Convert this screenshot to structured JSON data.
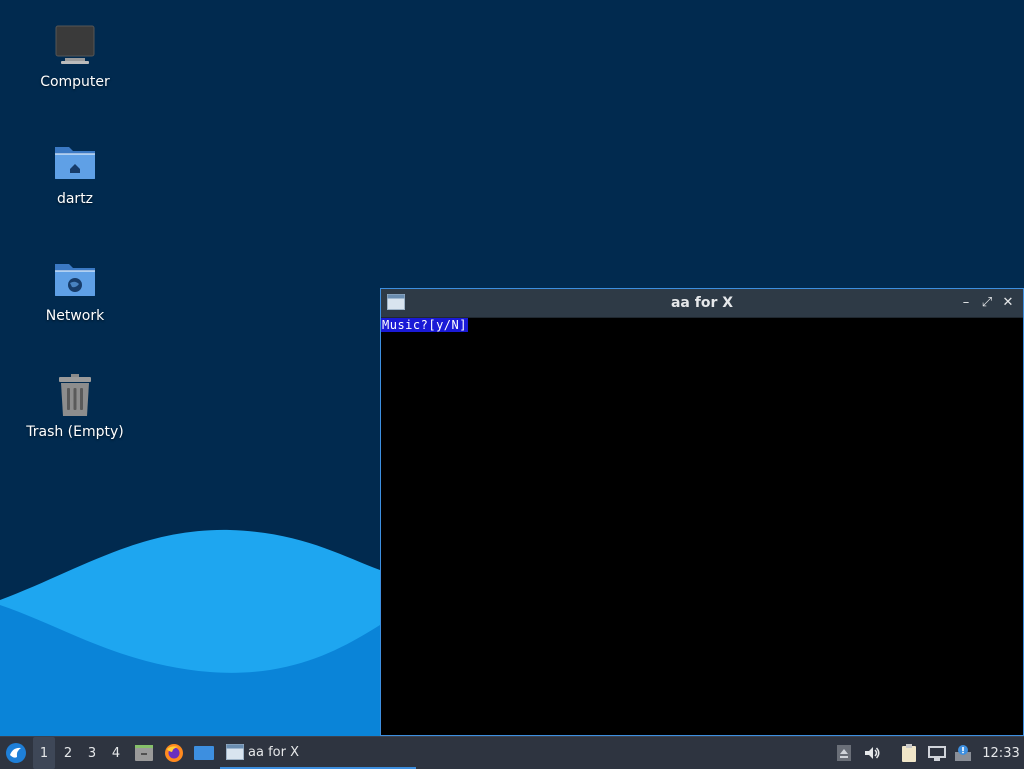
{
  "desktop": {
    "icons": [
      {
        "label": "Computer",
        "icon": "computer-icon"
      },
      {
        "label": "dartz",
        "icon": "home-folder-icon"
      },
      {
        "label": "Network",
        "icon": "network-folder-icon"
      },
      {
        "label": "Trash (Empty)",
        "icon": "trash-icon"
      }
    ]
  },
  "window": {
    "title": "aa for X",
    "prompt": "Music?[y/N]",
    "controls": {
      "minimize": "–",
      "maximize": "⤢",
      "close": "✕"
    }
  },
  "taskbar": {
    "workspaces": [
      "1",
      "2",
      "3",
      "4"
    ],
    "active_workspace": "1",
    "task_label": "aa for X",
    "clock": "12:33"
  },
  "colors": {
    "desktop_bg": "#012a4f",
    "wave_light": "#1ea6f0",
    "wave_dark": "#0a84d8",
    "accent": "#3d8fe0",
    "prompt_bg": "#1a1ad6"
  }
}
